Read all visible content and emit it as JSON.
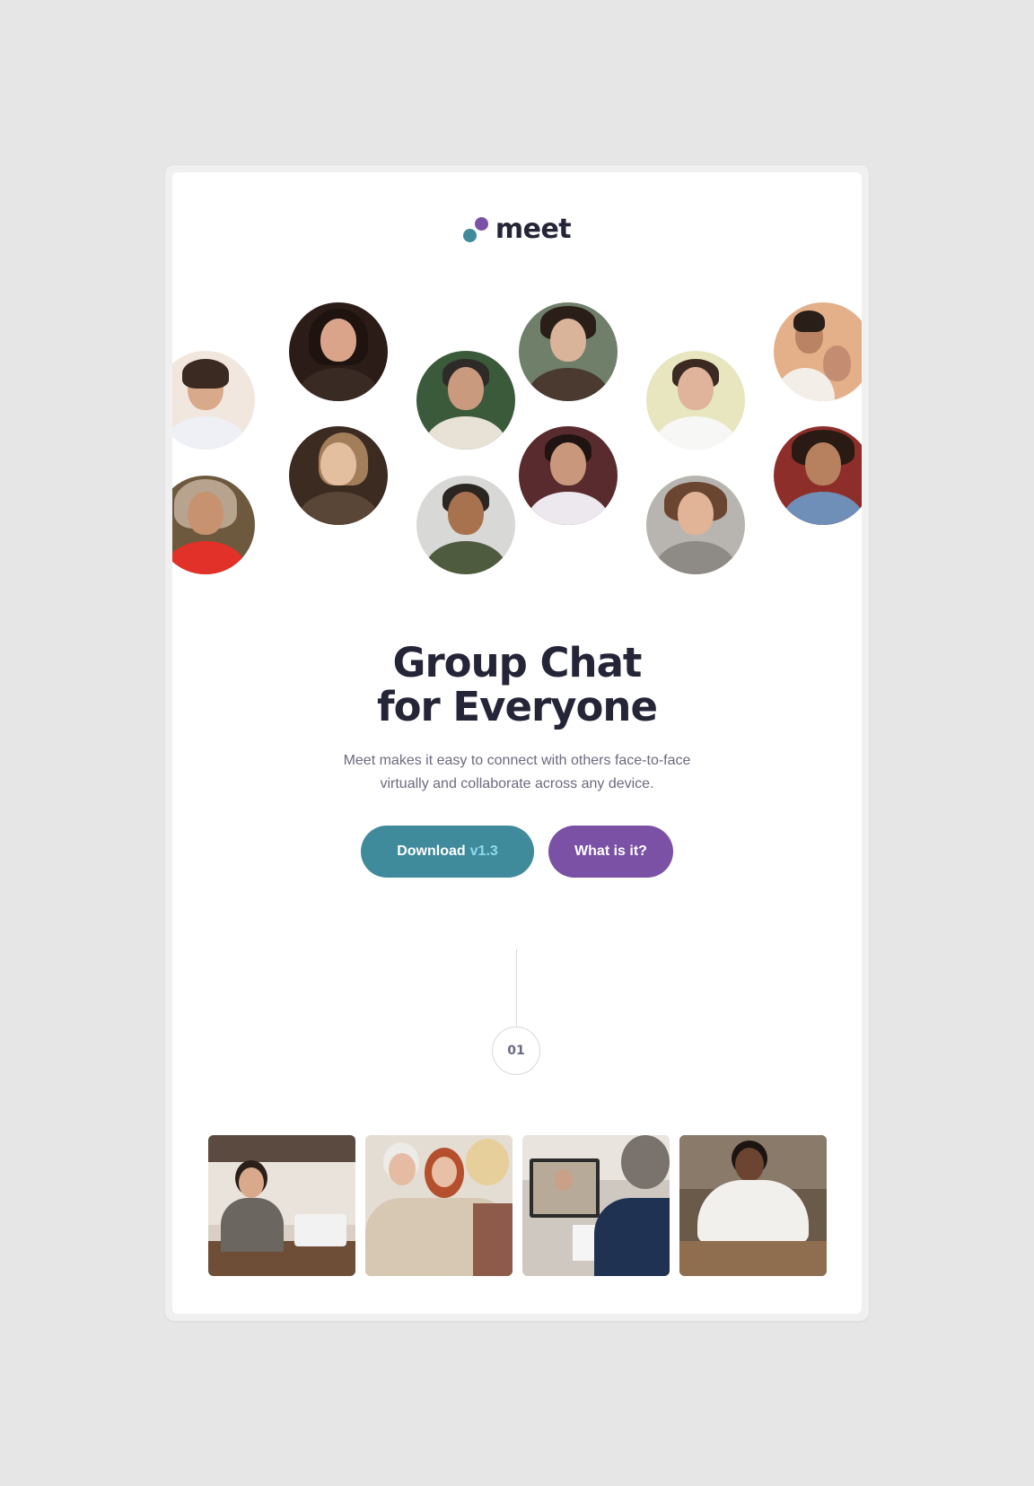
{
  "brand": {
    "name": "meet",
    "logo_icon": "two-dots-logo-icon",
    "colors": {
      "teal": "#3f8a9b",
      "purple": "#7b51a6",
      "navy": "#252538"
    }
  },
  "hero": {
    "headline_line1": "Group Chat",
    "headline_line2": "for Everyone",
    "description": "Meet makes it easy to connect with others face-to-face virtually and collaborate across any device."
  },
  "actions": {
    "download_label": "Download",
    "download_version": "v1.3",
    "what_label": "What is it?"
  },
  "step": {
    "number": "01"
  },
  "avatars": [
    {
      "name": "avatar-young-man-white-shirt"
    },
    {
      "name": "avatar-woman-smiling-dark-hair"
    },
    {
      "name": "avatar-man-glasses-shearling-jacket"
    },
    {
      "name": "avatar-man-sunglasses"
    },
    {
      "name": "avatar-man-laughing-white-tee"
    },
    {
      "name": "avatar-couple-autumn"
    },
    {
      "name": "avatar-man-fur-hood-beard"
    },
    {
      "name": "avatar-woman-sunlight-shadows"
    },
    {
      "name": "avatar-older-man-smiling"
    },
    {
      "name": "avatar-man-flowers-background"
    },
    {
      "name": "avatar-young-man-curly-hair"
    },
    {
      "name": "avatar-woman-denim-jacket"
    }
  ],
  "gallery": [
    {
      "name": "photo-woman-laptop-kitchen"
    },
    {
      "name": "photo-women-looking-at-phone"
    },
    {
      "name": "photo-man-video-call-laptop"
    },
    {
      "name": "photo-man-texting-on-phone"
    }
  ]
}
